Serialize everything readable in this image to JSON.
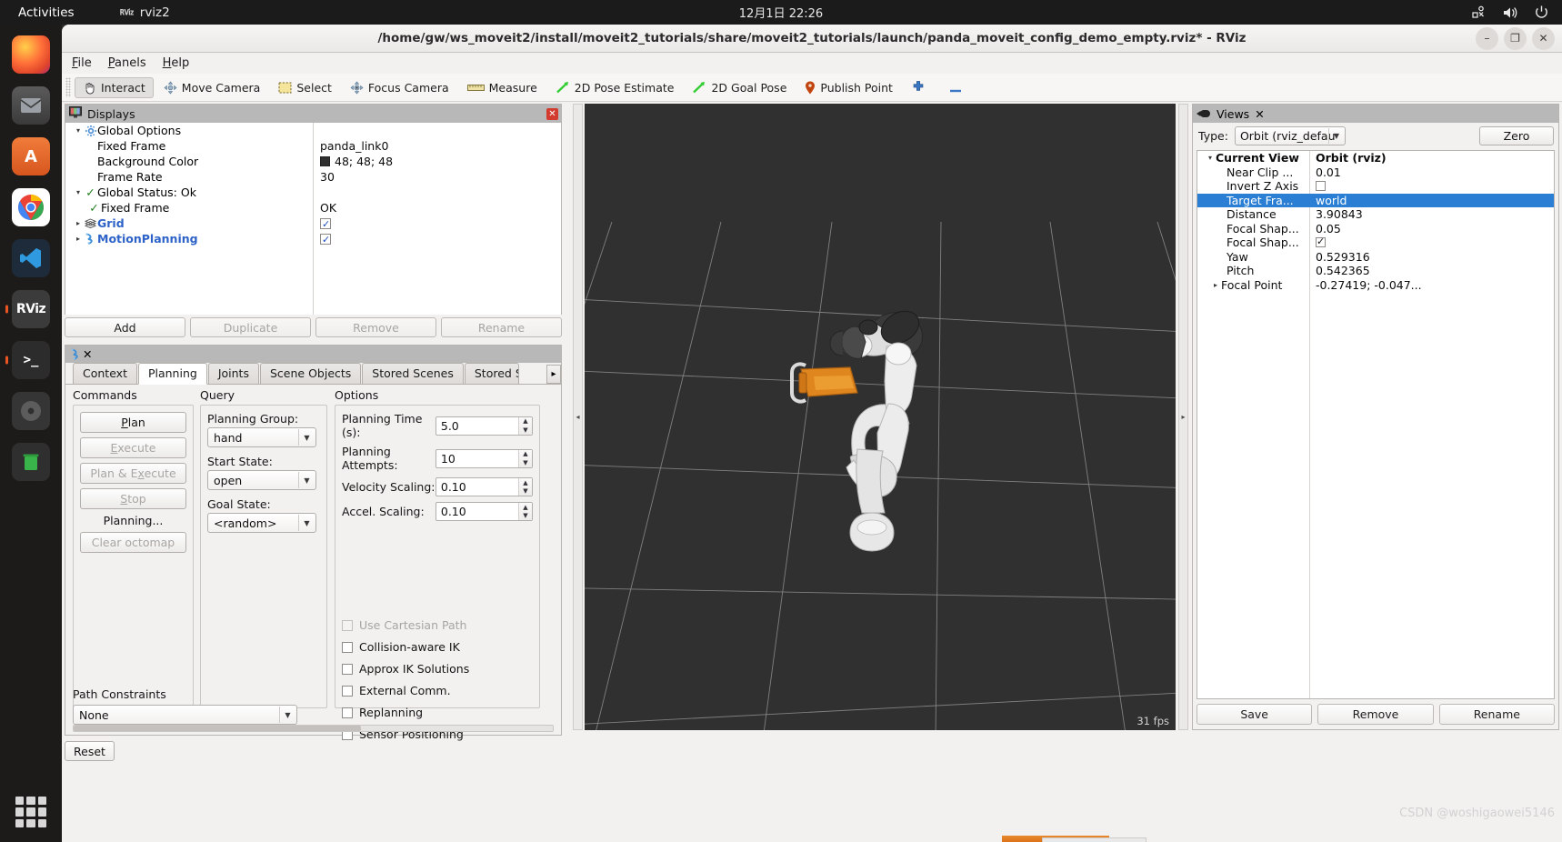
{
  "topbar": {
    "activities": "Activities",
    "app_name": "rviz2",
    "app_icon": "rviz-icon",
    "clock": "12月1日 22:26",
    "tray": [
      "accessibility-icon",
      "volume-icon",
      "power-icon"
    ]
  },
  "dock": {
    "items": [
      {
        "name": "firefox",
        "glyph": ""
      },
      {
        "name": "thunderbird",
        "glyph": ""
      },
      {
        "name": "ubuntu-software",
        "glyph": "A"
      },
      {
        "name": "chrome",
        "glyph": ""
      },
      {
        "name": "vscode",
        "glyph": ""
      },
      {
        "name": "rviz",
        "glyph": "RViz"
      },
      {
        "name": "terminal",
        "glyph": ">_"
      },
      {
        "name": "disc",
        "glyph": ""
      },
      {
        "name": "trash",
        "glyph": ""
      }
    ],
    "show_apps": "show-applications"
  },
  "window": {
    "title": "/home/gw/ws_moveit2/install/moveit2_tutorials/share/moveit2_tutorials/launch/panda_moveit_config_demo_empty.rviz* - RViz",
    "minimize": "–",
    "maximize": "❐",
    "close": "✕"
  },
  "menubar": {
    "items": [
      "File",
      "Panels",
      "Help"
    ]
  },
  "toolbar": {
    "buttons": [
      {
        "label": "Interact",
        "icon": "hand-icon",
        "active": true
      },
      {
        "label": "Move Camera",
        "icon": "move-camera-icon",
        "active": false
      },
      {
        "label": "Select",
        "icon": "select-rect-icon",
        "active": false
      },
      {
        "label": "Focus Camera",
        "icon": "focus-camera-icon",
        "active": false
      },
      {
        "label": "Measure",
        "icon": "ruler-icon",
        "active": false
      },
      {
        "label": "2D Pose Estimate",
        "icon": "green-arrow-icon",
        "active": false
      },
      {
        "label": "2D Goal Pose",
        "icon": "green-arrow-icon",
        "active": false
      },
      {
        "label": "Publish Point",
        "icon": "map-pin-icon",
        "active": false
      },
      {
        "label": "",
        "icon": "plus-icon",
        "active": false
      },
      {
        "label": "",
        "icon": "minus-icon",
        "active": false
      }
    ]
  },
  "displays": {
    "title": "Displays",
    "icon": "displays-icon",
    "close": "✕",
    "rows": [
      {
        "indent": 0,
        "arrow": "▾",
        "icon": "gear-icon",
        "label": "Global Options",
        "bold": false,
        "value": "",
        "value_type": "none"
      },
      {
        "indent": 1,
        "arrow": "",
        "icon": "",
        "label": "Fixed Frame",
        "bold": false,
        "value": "panda_link0",
        "value_type": "text"
      },
      {
        "indent": 1,
        "arrow": "",
        "icon": "",
        "label": "Background Color",
        "bold": false,
        "value": "48; 48; 48",
        "value_type": "color"
      },
      {
        "indent": 1,
        "arrow": "",
        "icon": "",
        "label": "Frame Rate",
        "bold": false,
        "value": "30",
        "value_type": "text"
      },
      {
        "indent": 0,
        "arrow": "▾",
        "icon": "check-icon",
        "label": "Global Status: Ok",
        "bold": false,
        "value": "",
        "value_type": "none"
      },
      {
        "indent": 1,
        "arrow": "",
        "icon": "check-icon",
        "label": "Fixed Frame",
        "bold": false,
        "value": "OK",
        "value_type": "text"
      },
      {
        "indent": 0,
        "arrow": "▸",
        "icon": "grid-icon",
        "label": "Grid",
        "bold": true,
        "value": "checked",
        "value_type": "checkbox"
      },
      {
        "indent": 0,
        "arrow": "▸",
        "icon": "motion-icon",
        "label": "MotionPlanning",
        "bold": true,
        "value": "checked",
        "value_type": "checkbox"
      }
    ],
    "buttons": [
      {
        "label": "Add",
        "enabled": true
      },
      {
        "label": "Duplicate",
        "enabled": false
      },
      {
        "label": "Remove",
        "enabled": false
      },
      {
        "label": "Rename",
        "enabled": false
      }
    ]
  },
  "motion_planning": {
    "panel_icon": "motion-icon",
    "close": "✕",
    "tabs": [
      {
        "label": "Context",
        "selected": false
      },
      {
        "label": "Planning",
        "selected": true
      },
      {
        "label": "Joints",
        "selected": false
      },
      {
        "label": "Scene Objects",
        "selected": false
      },
      {
        "label": "Stored Scenes",
        "selected": false
      },
      {
        "label": "Stored Sta",
        "selected": false
      }
    ],
    "tab_scroll": "▸",
    "commands": {
      "title": "Commands",
      "buttons": [
        {
          "label": "Plan",
          "enabled": true
        },
        {
          "label": "Execute",
          "enabled": false
        },
        {
          "label": "Plan & Execute",
          "enabled": false
        },
        {
          "label": "Stop",
          "enabled": false
        }
      ],
      "status": "Planning...",
      "clear_octomap": {
        "label": "Clear octomap",
        "enabled": false
      }
    },
    "query": {
      "title": "Query",
      "planning_group_label": "Planning Group:",
      "planning_group_value": "hand",
      "start_state_label": "Start State:",
      "start_state_value": "open",
      "goal_state_label": "Goal State:",
      "goal_state_value": "<random>"
    },
    "options": {
      "title": "Options",
      "fields": [
        {
          "label": "Planning Time (s):",
          "value": "5.0"
        },
        {
          "label": "Planning Attempts:",
          "value": "10"
        },
        {
          "label": "Velocity Scaling:",
          "value": "0.10"
        },
        {
          "label": "Accel. Scaling:",
          "value": "0.10"
        }
      ],
      "checkboxes": [
        {
          "label": "Use Cartesian Path",
          "checked": false,
          "enabled": false
        },
        {
          "label": "Collision-aware IK",
          "checked": false,
          "enabled": true
        },
        {
          "label": "Approx IK Solutions",
          "checked": false,
          "enabled": true
        },
        {
          "label": "External Comm.",
          "checked": false,
          "enabled": true
        },
        {
          "label": "Replanning",
          "checked": false,
          "enabled": true
        },
        {
          "label": "Sensor Positioning",
          "checked": false,
          "enabled": true
        }
      ]
    },
    "path_constraints": {
      "label": "Path Constraints",
      "value": "None"
    }
  },
  "reset_button": "Reset",
  "view3d": {
    "background_color": "#303030",
    "grid_color": "#8f8f8f",
    "fps": "31 fps",
    "robot": "panda-arm",
    "collapse_left": "◂",
    "collapse_right": "▸"
  },
  "views": {
    "title": "Views",
    "icon": "camera-icon",
    "close": "✕",
    "type_label": "Type:",
    "type_value": "Orbit (rviz_defau",
    "zero_button": "Zero",
    "tree": [
      {
        "key": "Current View",
        "value": "Orbit (rviz)",
        "bold": true,
        "arrow": "▾",
        "indent": 0,
        "highlight": false,
        "type": "text"
      },
      {
        "key": "Near Clip ...",
        "value": "0.01",
        "bold": false,
        "arrow": "",
        "indent": 1,
        "highlight": false,
        "type": "text"
      },
      {
        "key": "Invert Z Axis",
        "value": "unchecked",
        "bold": false,
        "arrow": "",
        "indent": 1,
        "highlight": false,
        "type": "checkbox"
      },
      {
        "key": "Target Fra...",
        "value": "world",
        "bold": false,
        "arrow": "",
        "indent": 1,
        "highlight": true,
        "type": "text"
      },
      {
        "key": "Distance",
        "value": "3.90843",
        "bold": false,
        "arrow": "",
        "indent": 1,
        "highlight": false,
        "type": "text"
      },
      {
        "key": "Focal Shap...",
        "value": "0.05",
        "bold": false,
        "arrow": "",
        "indent": 1,
        "highlight": false,
        "type": "text"
      },
      {
        "key": "Focal Shap...",
        "value": "checked",
        "bold": false,
        "arrow": "",
        "indent": 1,
        "highlight": false,
        "type": "checkbox"
      },
      {
        "key": "Yaw",
        "value": "0.529316",
        "bold": false,
        "arrow": "",
        "indent": 1,
        "highlight": false,
        "type": "text"
      },
      {
        "key": "Pitch",
        "value": "0.542365",
        "bold": false,
        "arrow": "",
        "indent": 1,
        "highlight": false,
        "type": "text"
      },
      {
        "key": "Focal Point",
        "value": "-0.27419; -0.047...",
        "bold": false,
        "arrow": "▸",
        "indent": 0,
        "highlight": false,
        "type": "text"
      }
    ],
    "buttons": [
      {
        "label": "Save",
        "enabled": true
      },
      {
        "label": "Remove",
        "enabled": true
      },
      {
        "label": "Rename",
        "enabled": true
      }
    ]
  },
  "watermark": "CSDN @woshigaowei5146"
}
